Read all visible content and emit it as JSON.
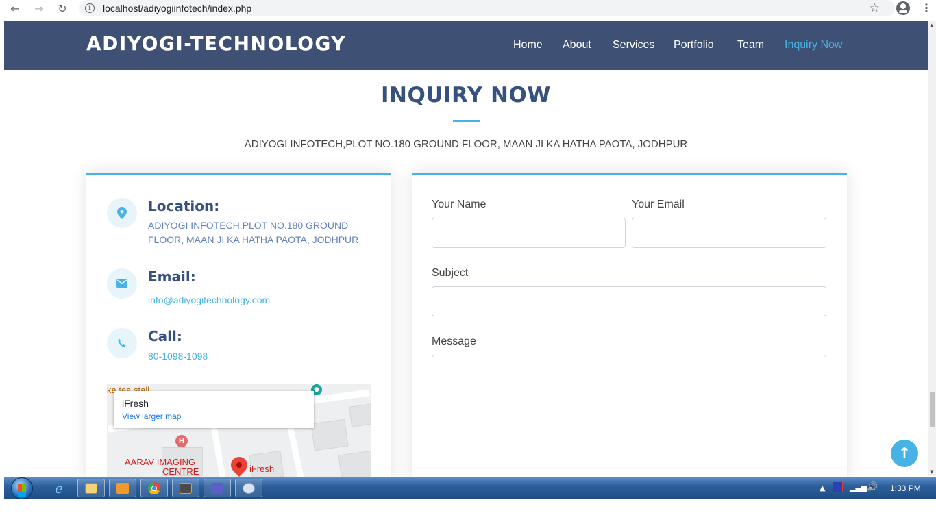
{
  "browser": {
    "url": "localhost/adiyogiinfotech/index.php"
  },
  "header": {
    "logo": "ADIYOGI-TECHNOLOGY",
    "nav": [
      {
        "label": "Home"
      },
      {
        "label": "About"
      },
      {
        "label": "Services"
      },
      {
        "label": "Portfolio"
      },
      {
        "label": "Team"
      },
      {
        "label": "Inquiry Now",
        "active": true
      }
    ],
    "active_color": "#47b2e4",
    "background_color": "#3e5073"
  },
  "section": {
    "title": "INQUIRY NOW",
    "subtitle": "ADIYOGI INFOTECH,PLOT NO.180 GROUND FLOOR, MAAN JI KA HATHA PAOTA, JODHPUR"
  },
  "contact": {
    "location": {
      "icon": "map-marker-icon",
      "heading": "Location:",
      "line1": "ADIYOGI INFOTECH,PLOT NO.180 GROUND",
      "line2": "FLOOR, MAAN JI KA HATHA PAOTA, JODHPUR"
    },
    "email": {
      "icon": "envelope-icon",
      "heading": "Email:",
      "value": "info@adiyogitechnology.com"
    },
    "call": {
      "icon": "phone-icon",
      "heading": "Call:",
      "value": "80-1098-1098"
    }
  },
  "map": {
    "popup_title": "iFresh",
    "popup_link": "View larger map",
    "top_label": "ka tea stall",
    "hospital_label_1": "AARAV IMAGING",
    "hospital_label_2": "CENTRE",
    "pin_label": "iFresh"
  },
  "form": {
    "name_label": "Your Name",
    "email_label": "Your Email",
    "subject_label": "Subject",
    "message_label": "Message"
  },
  "taskbar": {
    "clock": "1:33 PM"
  },
  "colors": {
    "accent": "#47b2e4",
    "title": "#37517e"
  }
}
